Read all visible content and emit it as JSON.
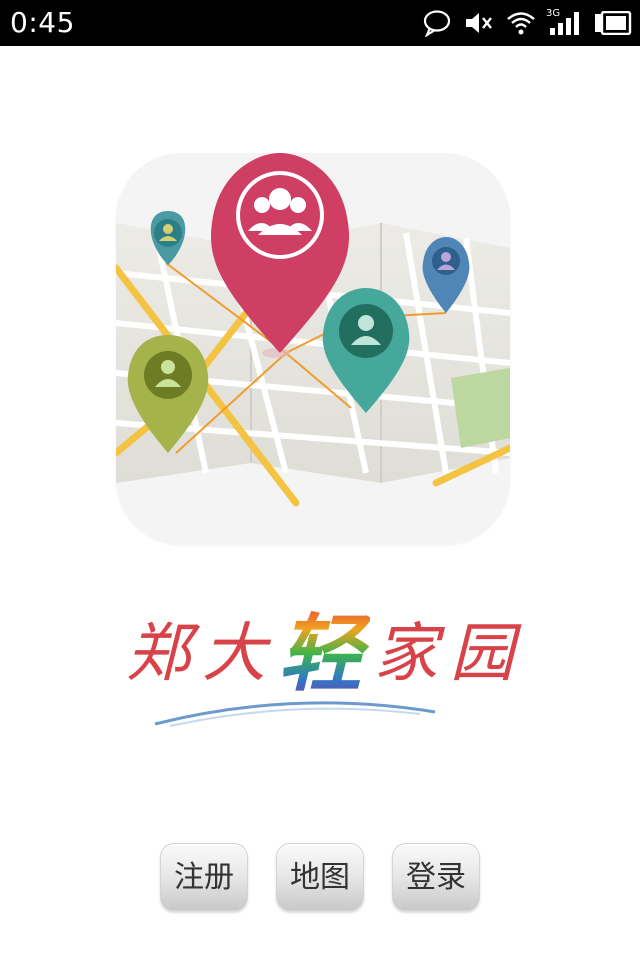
{
  "status_bar": {
    "time": "0:45",
    "network": "3G",
    "icons": [
      "message-icon",
      "mute-icon",
      "wifi-icon",
      "signal-icon",
      "battery-icon"
    ]
  },
  "app": {
    "icon_name": "map-pin-icon",
    "brand": {
      "chars": [
        "郑",
        "大",
        "轻",
        "家",
        "园"
      ]
    }
  },
  "buttons": {
    "register": "注册",
    "map": "地图",
    "login": "登录"
  },
  "colors": {
    "brand_red": "#d8434a",
    "pin_pink": "#cf3e63",
    "pin_teal": "#45a89a",
    "pin_olive": "#a4b44a",
    "pin_blue": "#4f86b5"
  }
}
